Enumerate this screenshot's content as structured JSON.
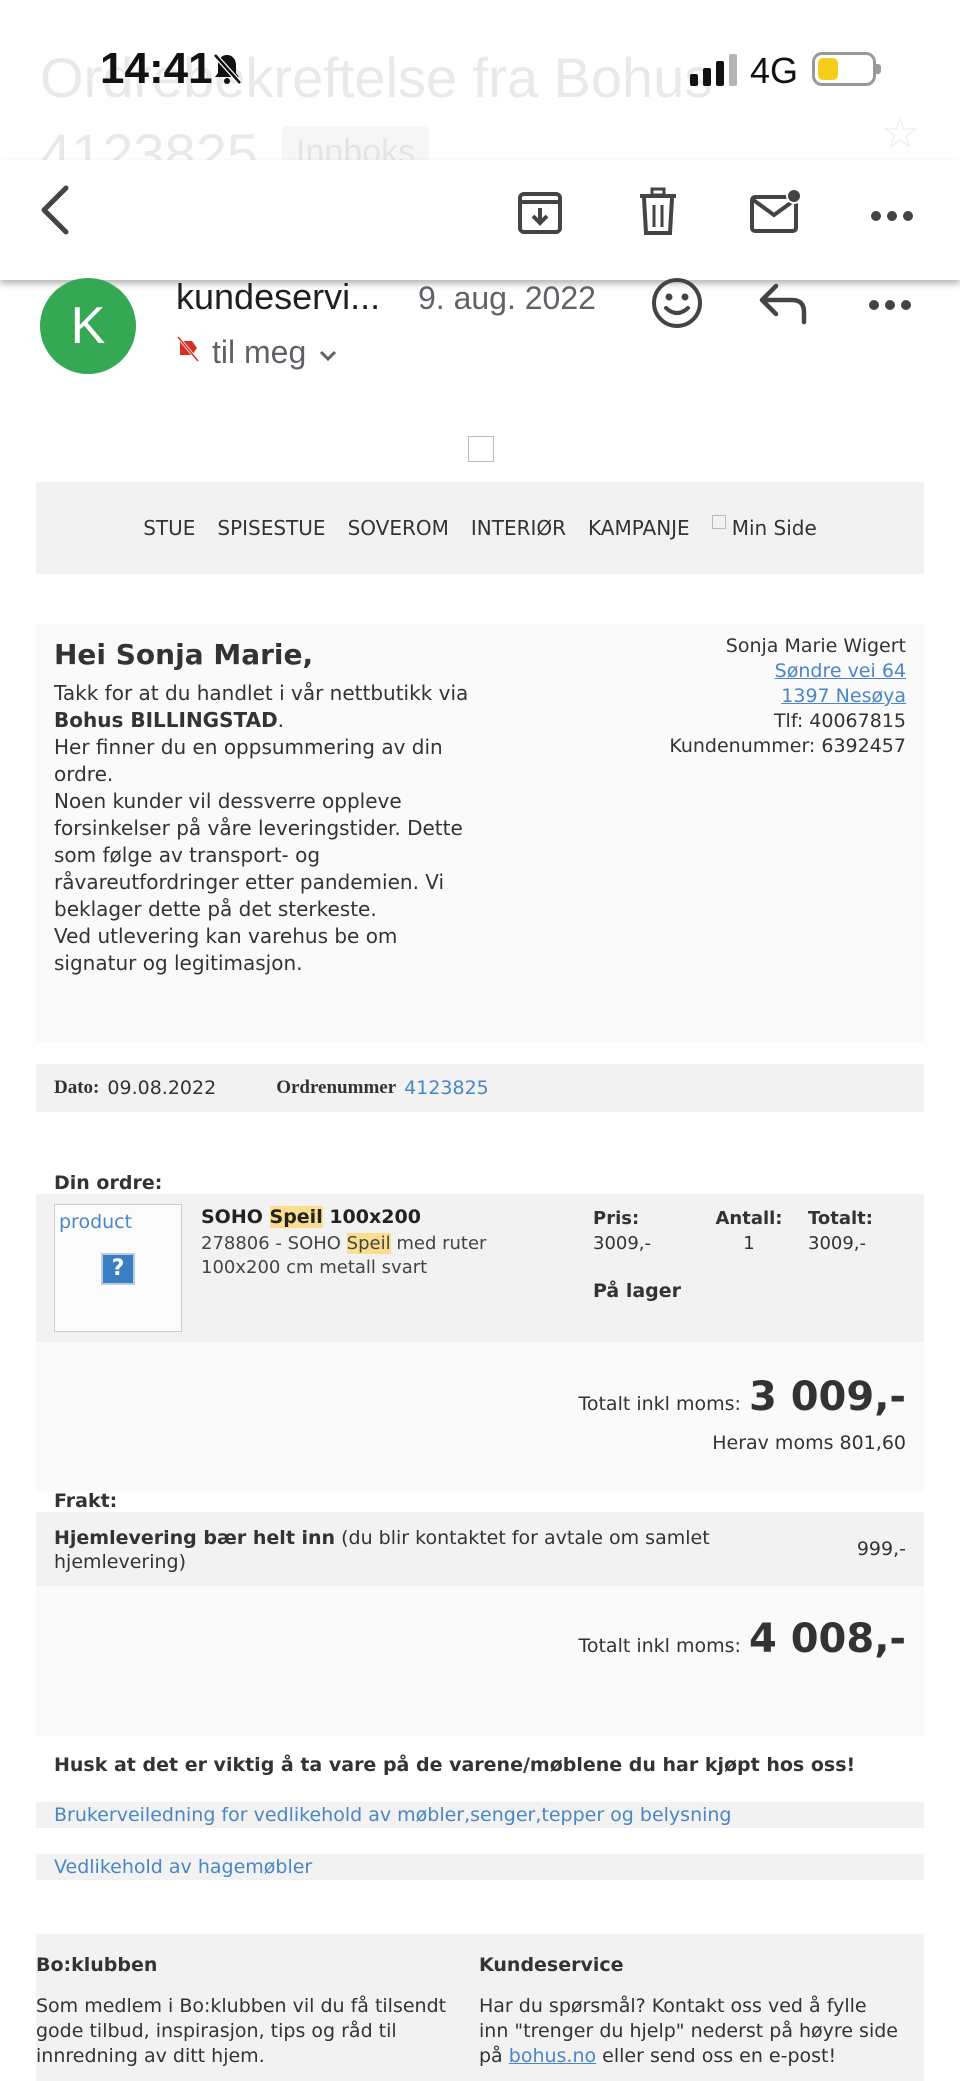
{
  "ghost": {
    "subject_line1": "Ordrebekreftelse fra Bohus",
    "subject_line2": "4123825",
    "label_badge": "Innboks"
  },
  "status_bar": {
    "time": "14:41",
    "network": "4G"
  },
  "toolbar": {
    "back": "back",
    "archive": "archive",
    "delete": "delete",
    "mark_unread": "mark-unread",
    "more": "more"
  },
  "sender": {
    "avatar_letter": "K",
    "name": "kundeservi...",
    "date": "9. aug. 2022",
    "to": "til meg"
  },
  "email": {
    "nav": [
      "STUE",
      "SPISESTUE",
      "SOVEROM",
      "INTERIØR",
      "KAMPANJE"
    ],
    "min_side": "Min Side",
    "greeting": "Hei Sonja Marie,",
    "intro": {
      "l1": "Takk for at du handlet i vår nettbutikk via",
      "store": "Bohus BILLINGSTAD",
      "dot": ".",
      "l2": "Her finner du en oppsummering av din ordre.",
      "l3": "Noen kunder vil dessverre oppleve forsinkelser på våre leveringstider. Dette som følge av transport- og råvareutfordringer etter pandemien. Vi beklager dette på det sterkeste.",
      "l4": "Ved utlevering kan varehus be om signatur og legitimasjon."
    },
    "address": {
      "name": "Sonja Marie Wigert",
      "street": "Søndre vei 64",
      "city": "1397 Nesøya",
      "phone": "Tlf: 40067815",
      "customer_no": "Kundenummer: 6392457"
    },
    "order": {
      "date_label": "Dato:",
      "date": "09.08.2022",
      "number_label": "Ordrenummer",
      "number": "4123825"
    },
    "your_order_label": "Din ordre:",
    "product": {
      "img_alt": "product",
      "name_pre": "SOHO ",
      "name_hl": "Speil",
      "name_post": " 100x200",
      "desc_pre": "278806 - SOHO ",
      "desc_hl": "Speil",
      "desc_post": " med ruter 100x200 cm metall svart",
      "price_label": "Pris:",
      "price": "3009,-",
      "qty_label": "Antall:",
      "qty": "1",
      "total_label": "Totalt:",
      "total": "3009,-",
      "stock": "På lager"
    },
    "subtotal": {
      "label": "Totalt inkl moms:",
      "amount": "3 009,-",
      "vat": "Herav moms 801,60"
    },
    "shipping": {
      "label": "Frakt:",
      "method": "Hjemlevering bær helt inn",
      "note": " (du blir kontaktet for avtale om samlet hjemlevering)",
      "price": "999,-"
    },
    "grand_total": {
      "label": "Totalt inkl moms:",
      "amount": "4 008,-"
    },
    "care_heading": "Husk at det er viktig å ta vare på de varene/møblene du har kjøpt hos oss!",
    "links": {
      "maintenance": "Brukerveiledning for vedlikehold av møbler,senger,tepper og belysning",
      "garden": "Vedlikehold av hagemøbler"
    },
    "footer": {
      "club_title": "Bo:klubben",
      "club_text": "Som medlem i Bo:klubben vil du få tilsendt gode tilbud, inspirasjon, tips og råd til innredning av ditt hjem.",
      "service_title": "Kundeservice",
      "service_text": "Har du spørsmål? Kontakt oss ved å fylle inn \"trenger du hjelp\" nederst på høyre side på",
      "service_link": "bohus.no",
      "service_text2": " eller send oss en e-post!"
    }
  },
  "colors": {
    "avatar": "#34a853",
    "link": "#4a86c5",
    "highlight": "#fbdd8f",
    "battery": "#f6cd1b"
  }
}
